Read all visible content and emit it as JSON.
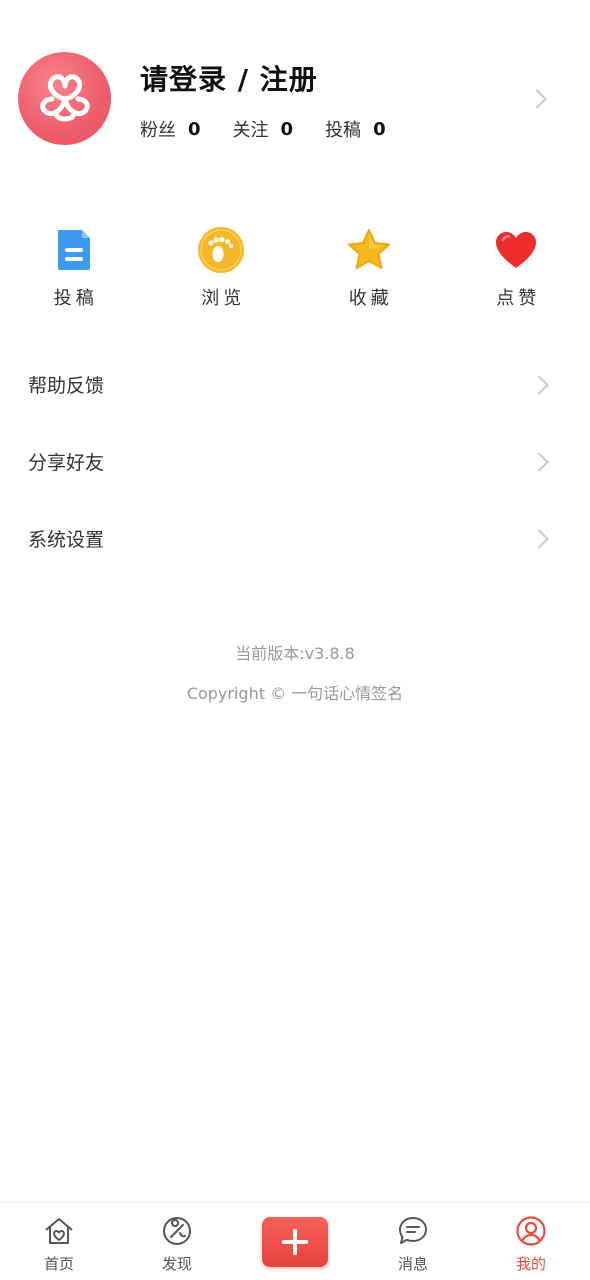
{
  "profile": {
    "title": "请登录 / 注册",
    "stats": [
      {
        "label": "粉丝",
        "value": "0"
      },
      {
        "label": "关注",
        "value": "0"
      },
      {
        "label": "投稿",
        "value": "0"
      }
    ]
  },
  "actions": [
    {
      "label": "投稿",
      "icon": "document-icon",
      "color": "#3d9af0"
    },
    {
      "label": "浏览",
      "icon": "footprint-icon",
      "color": "#f5b82a"
    },
    {
      "label": "收藏",
      "icon": "star-icon",
      "color": "#f6b81f"
    },
    {
      "label": "点赞",
      "icon": "heart-icon",
      "color": "#ee2d2d"
    }
  ],
  "menu": [
    {
      "label": "帮助反馈"
    },
    {
      "label": "分享好友"
    },
    {
      "label": "系统设置"
    }
  ],
  "footer": {
    "version": "当前版本:v3.8.8",
    "copyright": "Copyright © 一句话心情签名"
  },
  "tabs": [
    {
      "label": "首页",
      "icon": "home-icon"
    },
    {
      "label": "发现",
      "icon": "discover-icon"
    },
    {
      "label": "",
      "icon": "plus-icon"
    },
    {
      "label": "消息",
      "icon": "message-icon"
    },
    {
      "label": "我的",
      "icon": "user-icon",
      "active": true
    }
  ],
  "colors": {
    "accent": "#e84c3d",
    "avatar": "#ee5d6b"
  }
}
